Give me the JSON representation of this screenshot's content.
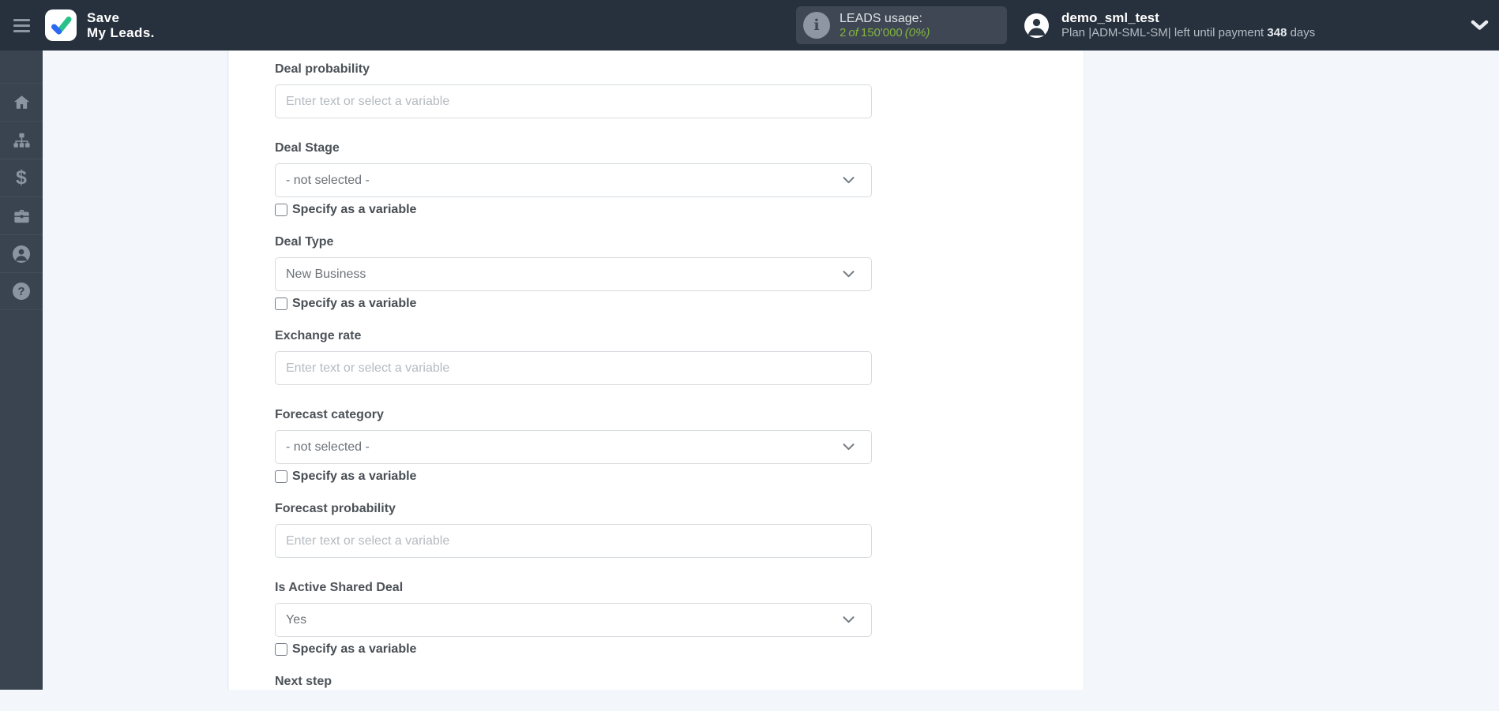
{
  "header": {
    "logo_line1": "Save",
    "logo_line2": "My Leads.",
    "usage": {
      "title": "LEADS usage:",
      "used": "2",
      "of_word": "of",
      "total": "150'000",
      "percent": "(0%)"
    },
    "user": {
      "name": "demo_sml_test",
      "plan_prefix": "Plan |ADM-SML-SM| left until payment",
      "days": "348",
      "days_word": "days"
    }
  },
  "sidebar": {
    "items": [
      {
        "icon": "home-icon"
      },
      {
        "icon": "sitemap-icon"
      },
      {
        "icon": "dollar-icon"
      },
      {
        "icon": "briefcase-icon"
      },
      {
        "icon": "account-icon"
      },
      {
        "icon": "help-icon"
      }
    ]
  },
  "form": {
    "checkbox_label": "Specify as a variable",
    "fields": [
      {
        "label": "Deal probability",
        "type": "text",
        "placeholder": "Enter text or select a variable",
        "checkbox": false
      },
      {
        "label": "Deal Stage",
        "type": "select",
        "value": "- not selected -",
        "checkbox": true
      },
      {
        "label": "Deal Type",
        "type": "select",
        "value": "New Business",
        "checkbox": true
      },
      {
        "label": "Exchange rate",
        "type": "text",
        "placeholder": "Enter text or select a variable",
        "checkbox": false
      },
      {
        "label": "Forecast category",
        "type": "select",
        "value": "- not selected -",
        "checkbox": true
      },
      {
        "label": "Forecast probability",
        "type": "text",
        "placeholder": "Enter text or select a variable",
        "checkbox": false
      },
      {
        "label": "Is Active Shared Deal",
        "type": "select",
        "value": "Yes",
        "checkbox": true
      },
      {
        "label": "Next step",
        "type": "label-only",
        "checkbox": false
      }
    ]
  },
  "colors": {
    "header_bg": "#27303d",
    "sidebar_bg": "#3a4350",
    "badge_bg": "#3e4753",
    "accent_green": "#82b440",
    "panel_bg": "#f3f6fa",
    "card_bg": "#ffffff",
    "border": "#d6dbdf",
    "label_text": "#4c5258"
  }
}
